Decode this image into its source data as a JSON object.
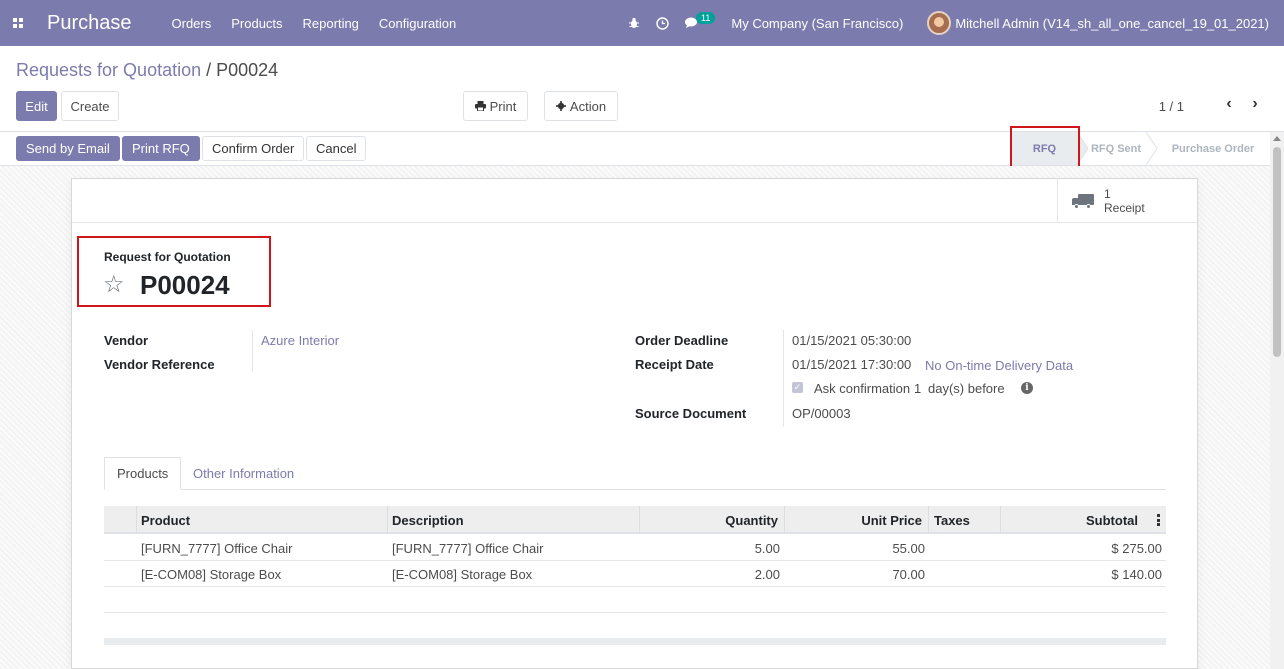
{
  "navbar": {
    "brand": "Purchase",
    "menu": [
      "Orders",
      "Products",
      "Reporting",
      "Configuration"
    ],
    "chat_badge": "11",
    "company": "My Company (San Francisco)",
    "user": "Mitchell Admin (V14_sh_all_one_cancel_19_01_2021)",
    "icons": [
      "apps-icon",
      "bug-icon",
      "clock-icon",
      "chat-icon"
    ]
  },
  "breadcrumb": {
    "parent": "Requests for Quotation",
    "separator": " / ",
    "current": "P00024"
  },
  "control": {
    "edit": "Edit",
    "create": "Create",
    "print": "Print",
    "action": "Action",
    "pager": "1 / 1"
  },
  "statusbar": {
    "buttons": [
      "Send by Email",
      "Print RFQ",
      "Confirm Order",
      "Cancel"
    ],
    "stages": [
      "RFQ",
      "RFQ Sent",
      "Purchase Order"
    ],
    "active_stage": "RFQ"
  },
  "smart_button": {
    "count": "1",
    "label": "Receipt"
  },
  "header": {
    "label": "Request for Quotation",
    "name": "P00024"
  },
  "fields": {
    "vendor_label": "Vendor",
    "vendor": "Azure Interior",
    "vendor_ref_label": "Vendor Reference",
    "vendor_ref": "",
    "deadline_label": "Order Deadline",
    "deadline": "01/15/2021 05:30:00",
    "receipt_label": "Receipt Date",
    "receipt": "01/15/2021 17:30:00",
    "delivery_link": "No On-time Delivery Data",
    "ask_confirmation": "Ask confirmation",
    "ask_days": "1",
    "ask_suffix": "day(s) before",
    "source_label": "Source Document",
    "source": "OP/00003"
  },
  "tabs": [
    "Products",
    "Other Information"
  ],
  "table": {
    "columns": [
      "Product",
      "Description",
      "Quantity",
      "Unit Price",
      "Taxes",
      "Subtotal"
    ],
    "rows": [
      {
        "product": "[FURN_7777] Office Chair",
        "description": "[FURN_7777] Office Chair",
        "quantity": "5.00",
        "unit_price": "55.00",
        "taxes": "",
        "subtotal": "$ 275.00"
      },
      {
        "product": "[E-COM08] Storage Box",
        "description": "[E-COM08] Storage Box",
        "quantity": "2.00",
        "unit_price": "70.00",
        "taxes": "",
        "subtotal": "$ 140.00"
      }
    ]
  },
  "colors": {
    "primary": "#7c7bad",
    "highlight": "#d0161b",
    "badge": "#00a09d"
  }
}
